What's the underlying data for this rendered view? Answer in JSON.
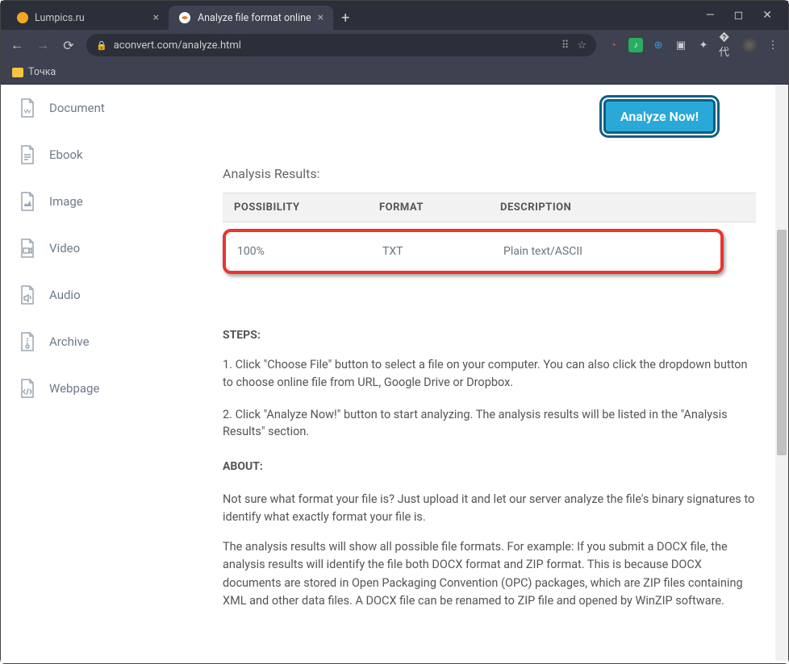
{
  "window": {
    "tabs": [
      {
        "title": "Lumpics.ru",
        "active": false
      },
      {
        "title": "Analyze file format online",
        "active": true
      }
    ]
  },
  "toolbar": {
    "url_display": "aconvert.com/analyze.html"
  },
  "bookmarks": {
    "items": [
      {
        "label": "Точка"
      }
    ]
  },
  "sidebar": {
    "items": [
      {
        "label": "Document",
        "icon": "document"
      },
      {
        "label": "Ebook",
        "icon": "ebook"
      },
      {
        "label": "Image",
        "icon": "image"
      },
      {
        "label": "Video",
        "icon": "video"
      },
      {
        "label": "Audio",
        "icon": "audio"
      },
      {
        "label": "Archive",
        "icon": "archive"
      },
      {
        "label": "Webpage",
        "icon": "webpage"
      }
    ]
  },
  "main": {
    "analyze_button": "Analyze Now!",
    "results_title": "Analysis Results:",
    "results_headers": {
      "possibility": "POSSIBILITY",
      "format": "FORMAT",
      "description": "DESCRIPTION"
    },
    "results_rows": [
      {
        "possibility": "100%",
        "format": "TXT",
        "description": "Plain text/ASCII"
      }
    ],
    "steps_title": "STEPS:",
    "steps": [
      "1. Click \"Choose File\" button to select a file on your computer. You can also click the dropdown button to choose online file from URL, Google Drive or Dropbox.",
      "2. Click \"Analyze Now!\" button to start analyzing. The analysis results will be listed in the \"Analysis Results\" section."
    ],
    "about_title": "ABOUT:",
    "about_paragraphs": [
      "Not sure what format your file is? Just upload it and let our server analyze the file's binary signatures to identify what exactly format your file is.",
      "The analysis results will show all possible file formats. For example: If you submit a DOCX file, the analysis results will identify the file both DOCX format and ZIP format. This is because DOCX documents are stored in Open Packaging Convention (OPC) packages, which are ZIP files containing XML and other data files. A DOCX file can be renamed to ZIP file and opened by WinZIP software."
    ]
  }
}
